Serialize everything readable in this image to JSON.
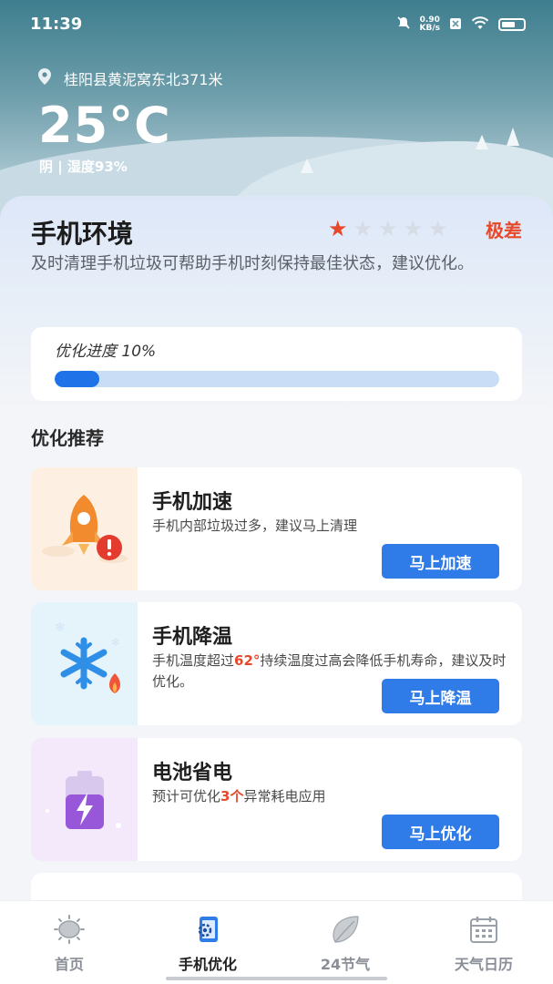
{
  "status_bar": {
    "time": "11:39",
    "net_speed_value": "0.90",
    "net_speed_unit": "KB/s",
    "icons": [
      "mute-icon",
      "sim-off-icon",
      "wifi-icon",
      "battery-icon"
    ]
  },
  "weather": {
    "location": "桂阳县黄泥窝东北371米",
    "temperature": "25°C",
    "description": "阴 | 湿度93%"
  },
  "environment": {
    "title": "手机环境",
    "rating": 1,
    "rating_max": 5,
    "rating_label": "极差",
    "description": "及时清理手机垃圾可帮助手机时刻保持最佳状态，建议优化。",
    "colors": {
      "star_on": "#e8482a",
      "star_off": "#d6dce6"
    }
  },
  "progress": {
    "label": "优化进度 10%",
    "value": 0.1
  },
  "recommendations": {
    "title": "优化推荐",
    "items": [
      {
        "title": "手机加速",
        "desc": "手机内部垃圾过多，建议马上清理",
        "button": "马上加速",
        "icon": "rocket-icon"
      },
      {
        "title": "手机降温",
        "desc_prefix": "手机温度超过",
        "desc_highlight": "62°",
        "desc_suffix": "持续温度过高会降低手机寿命，建议及时优化。",
        "button": "马上降温",
        "icon": "snowflake-icon"
      },
      {
        "title": "电池省电",
        "desc_prefix": "预计可优化",
        "desc_highlight": "3个",
        "desc_suffix": "异常耗电应用",
        "button": "马上优化",
        "icon": "battery-charge-icon"
      }
    ]
  },
  "nav": {
    "items": [
      {
        "label": "首页",
        "icon": "sun-icon",
        "active": false
      },
      {
        "label": "手机优化",
        "icon": "phone-optimize-icon",
        "active": true
      },
      {
        "label": "24节气",
        "icon": "leaf-icon",
        "active": false
      },
      {
        "label": "天气日历",
        "icon": "calendar-icon",
        "active": false
      }
    ]
  },
  "colors": {
    "accent": "#2f7be8",
    "progress_fill": "#1f72e8",
    "warning": "#e8482a"
  }
}
